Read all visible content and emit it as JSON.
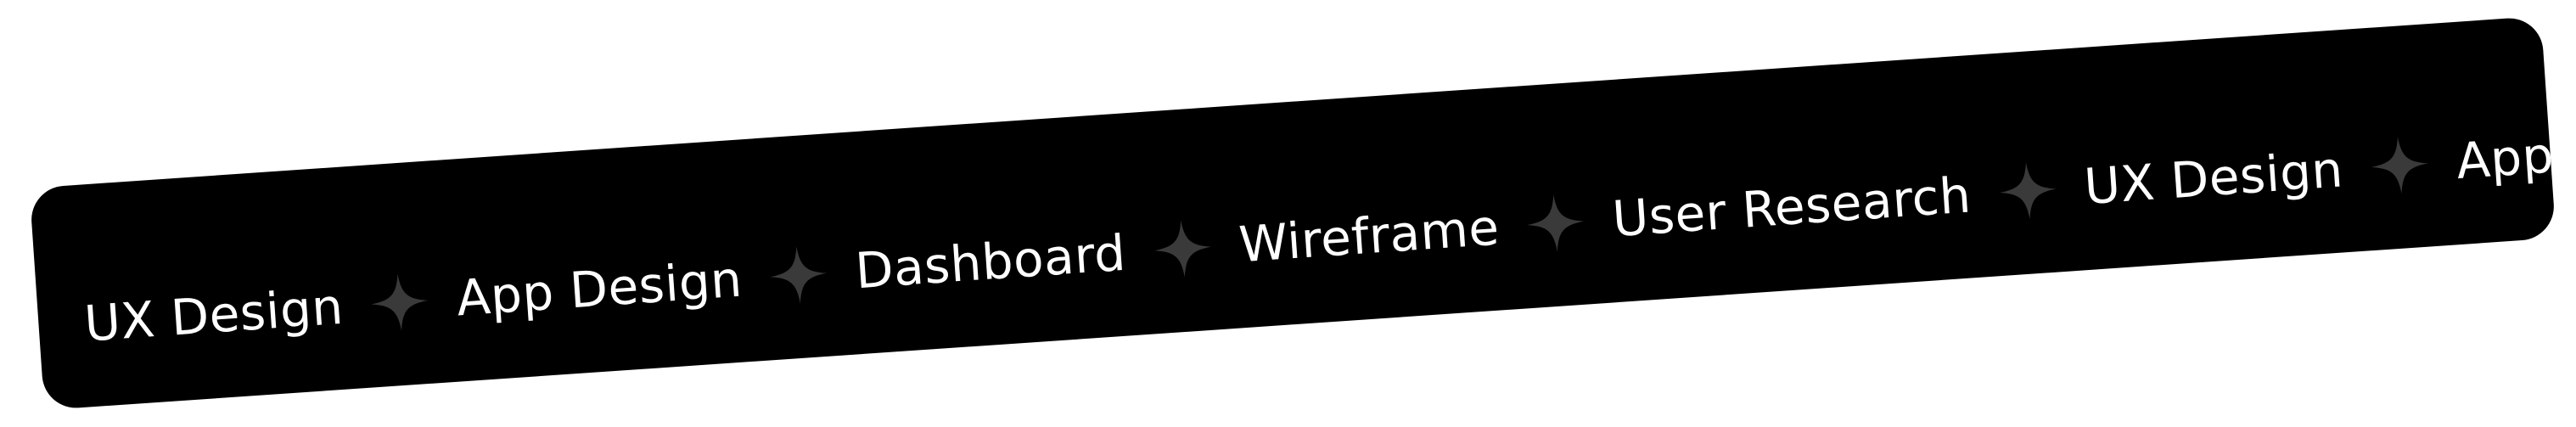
{
  "ticker": {
    "items": [
      "UX Design",
      "App Design",
      "Dashboard",
      "Wireframe",
      "User Research",
      "UX Design",
      "App De"
    ],
    "separator_icon": "sparkle-icon",
    "colors": {
      "band": "#000000",
      "text": "#ffffff",
      "separator": "#3a3a3a",
      "background": "#ffffff"
    }
  }
}
